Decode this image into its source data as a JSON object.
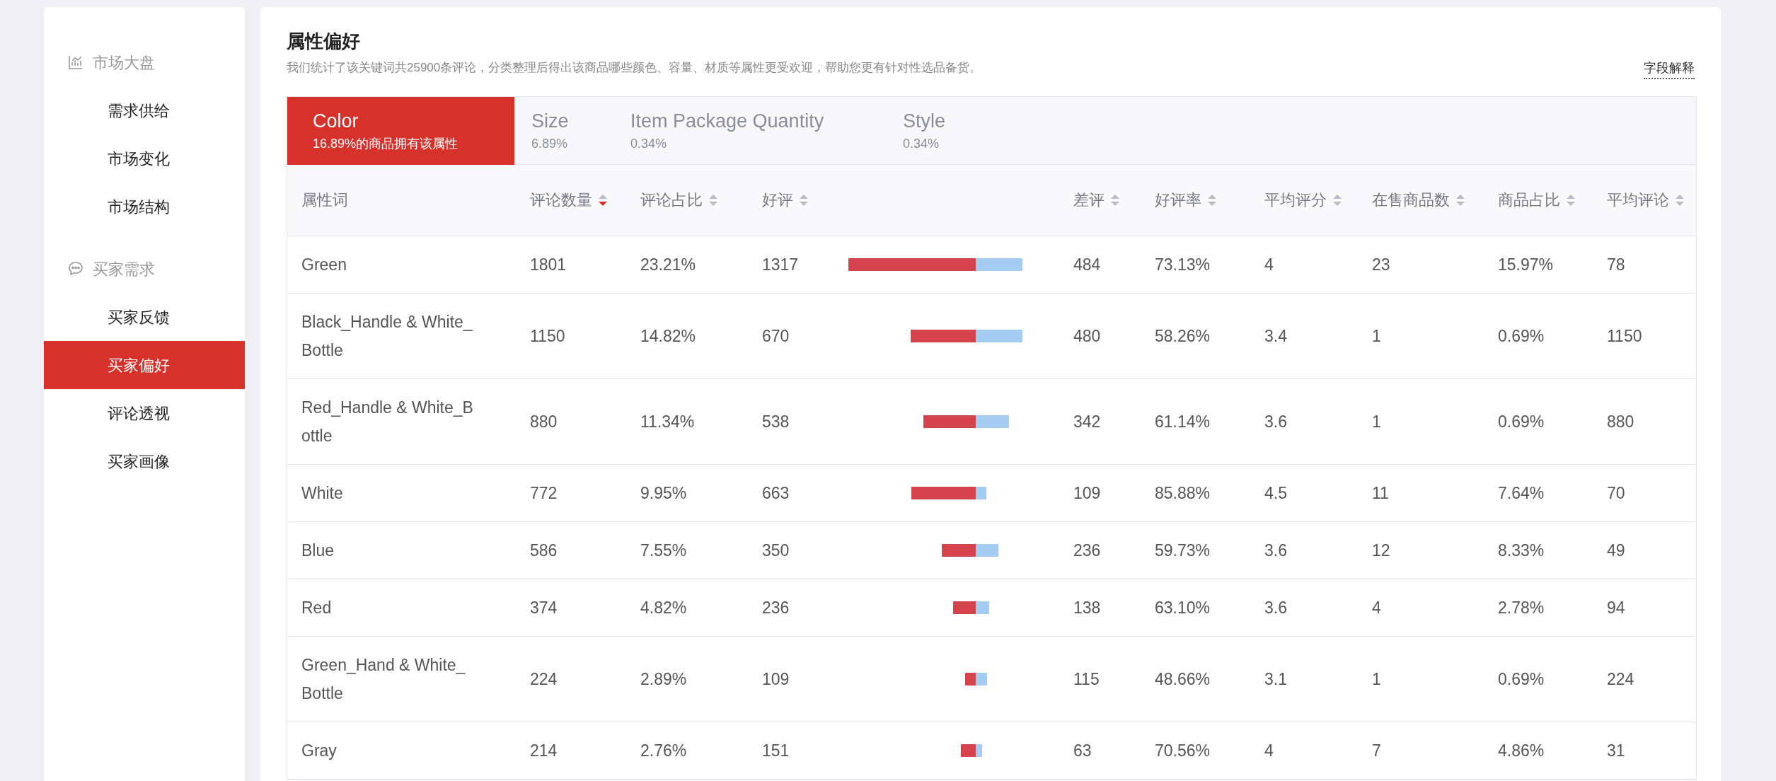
{
  "sidebar": {
    "groups": [
      {
        "label": "市场大盘",
        "kind": "chart",
        "items": [
          {
            "label": "需求供给",
            "selected": false
          },
          {
            "label": "市场变化",
            "selected": false
          },
          {
            "label": "市场结构",
            "selected": false
          }
        ]
      },
      {
        "label": "买家需求",
        "kind": "chat",
        "items": [
          {
            "label": "买家反馈",
            "selected": false
          },
          {
            "label": "买家偏好",
            "selected": true
          },
          {
            "label": "评论透视",
            "selected": false
          },
          {
            "label": "买家画像",
            "selected": false
          }
        ]
      }
    ]
  },
  "panel": {
    "title": "属性偏好",
    "description": "我们统计了该关键词共25900条评论，分类整理后得出该商品哪些颜色、容量、材质等属性更受欢迎，帮助您更有针对性选品备货。",
    "help_link": "字段解释"
  },
  "tabs": [
    {
      "label": "Color",
      "share": "16.89%的商品拥有该属性",
      "selected": true
    },
    {
      "label": "Size",
      "share": "6.89%",
      "selected": false
    },
    {
      "label": "Item Package Quantity",
      "share": "0.34%",
      "selected": false
    },
    {
      "label": "Style",
      "share": "0.34%",
      "selected": false
    }
  ],
  "table": {
    "columns": [
      {
        "kind": "text",
        "label": "属性词"
      },
      {
        "kind": "text",
        "label": "评论数量",
        "sorted": true
      },
      {
        "kind": "text",
        "label": "评论占比",
        "sorted": false
      },
      {
        "kind": "positive",
        "label": "好评",
        "sorted": false
      },
      {
        "kind": "bar"
      },
      {
        "kind": "negative",
        "label": "差评",
        "sorted": false
      },
      {
        "kind": "text",
        "label": "好评率",
        "sorted": false
      },
      {
        "kind": "text",
        "label": "平均评分",
        "sorted": false
      },
      {
        "kind": "text",
        "label": "在售商品数",
        "sorted": false
      },
      {
        "kind": "text",
        "label": "商品占比",
        "sorted": false
      },
      {
        "kind": "text",
        "label": "平均评论",
        "sorted": false
      }
    ],
    "rows": [
      {
        "cells": [
          "Green",
          "1801",
          "23.21%",
          "1317",
          "",
          "484",
          "73.13%",
          "4",
          "23",
          "15.97%",
          "78"
        ]
      },
      {
        "cells": [
          "Black_Handle & White_Bottle",
          "1150",
          "14.82%",
          "670",
          "",
          "480",
          "58.26%",
          "3.4",
          "1",
          "0.69%",
          "1150"
        ]
      },
      {
        "cells": [
          "Red_Handle & White_Bottle",
          "880",
          "11.34%",
          "538",
          "",
          "342",
          "61.14%",
          "3.6",
          "1",
          "0.69%",
          "880"
        ]
      },
      {
        "cells": [
          "White",
          "772",
          "9.95%",
          "663",
          "",
          "109",
          "85.88%",
          "4.5",
          "11",
          "7.64%",
          "70"
        ]
      },
      {
        "cells": [
          "Blue",
          "586",
          "7.55%",
          "350",
          "",
          "236",
          "59.73%",
          "3.6",
          "12",
          "8.33%",
          "49"
        ]
      },
      {
        "cells": [
          "Red",
          "374",
          "4.82%",
          "236",
          "",
          "138",
          "63.10%",
          "3.6",
          "4",
          "2.78%",
          "94"
        ]
      },
      {
        "cells": [
          "Green_Hand & White_Bottle",
          "224",
          "2.89%",
          "109",
          "",
          "115",
          "48.66%",
          "3.1",
          "1",
          "0.69%",
          "224"
        ]
      },
      {
        "cells": [
          "Gray",
          "214",
          "2.76%",
          "151",
          "",
          "63",
          "70.56%",
          "4",
          "7",
          "4.86%",
          "31"
        ]
      }
    ]
  }
}
